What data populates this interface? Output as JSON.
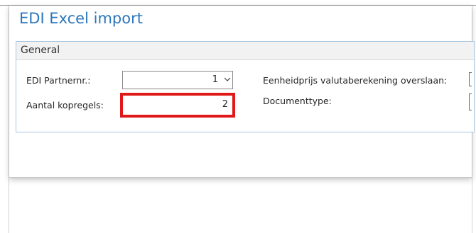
{
  "dialog": {
    "title": "EDI Excel import",
    "section": {
      "title": "General",
      "fields": {
        "partner_label": "EDI Partnernr.:",
        "partner_value": "1",
        "header_lines_label": "Aantal kopregels:",
        "header_lines_value": "2",
        "skip_currency_label": "Eenheidprijs valutaberekening overslaan:",
        "document_type_label": "Documenttype:"
      }
    }
  },
  "colors": {
    "title": "#2b76bd",
    "section_border": "#a7c7e3",
    "highlight": "#e01818"
  },
  "icons": {
    "dropdown": "chevron-down-icon"
  }
}
